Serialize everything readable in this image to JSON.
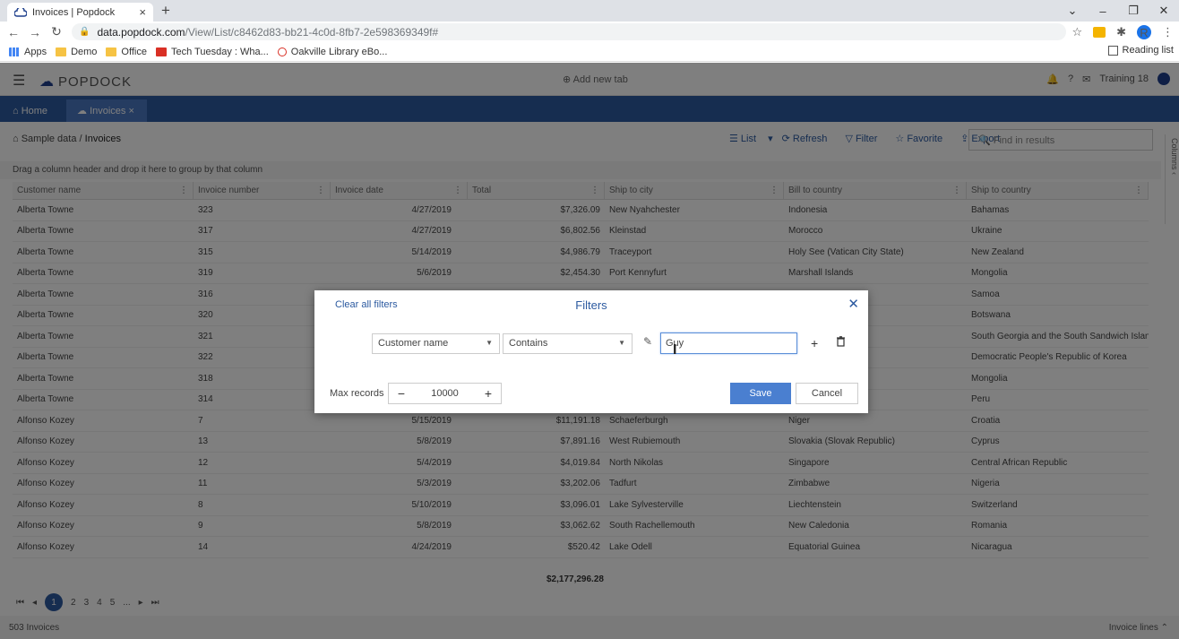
{
  "browser": {
    "tab_title": "Invoices | Popdock",
    "url_host": "data.popdock.com",
    "url_path": "/View/List/c8462d83-bb21-4c0d-8fb7-2e598369349f#",
    "bookmarks": [
      "Apps",
      "Demo",
      "Office",
      "Tech Tuesday : Wha...",
      "Oakville Library eBo..."
    ],
    "reading_list": "Reading list",
    "profile_initial": "R"
  },
  "app": {
    "logo": "POPDOCK",
    "add_new_tab": "Add new tab",
    "user": "Training 18",
    "tabs": [
      "Home",
      "Invoices"
    ],
    "breadcrumb_root": "Sample data",
    "breadcrumb_current": "Invoices",
    "toolbar": [
      "List",
      "Refresh",
      "Filter",
      "Favorite",
      "Export"
    ],
    "find_placeholder": "Find in results",
    "columns_label": "Columns",
    "group_hint": "Drag a column header and drop it here to group by that column",
    "columns": [
      "Customer name",
      "Invoice number",
      "Invoice date",
      "Total",
      "Ship to city",
      "Bill to country",
      "Ship to country"
    ],
    "rows": [
      [
        "Alberta Towne",
        "323",
        "4/27/2019",
        "$7,326.09",
        "New Nyahchester",
        "Indonesia",
        "Bahamas"
      ],
      [
        "Alberta Towne",
        "317",
        "4/27/2019",
        "$6,802.56",
        "Kleinstad",
        "Morocco",
        "Ukraine"
      ],
      [
        "Alberta Towne",
        "315",
        "5/14/2019",
        "$4,986.79",
        "Traceyport",
        "Holy See (Vatican City State)",
        "New Zealand"
      ],
      [
        "Alberta Towne",
        "319",
        "5/6/2019",
        "$2,454.30",
        "Port Kennyfurt",
        "Marshall Islands",
        "Mongolia"
      ],
      [
        "Alberta Towne",
        "316",
        "",
        "",
        "",
        "",
        "Samoa"
      ],
      [
        "Alberta Towne",
        "320",
        "",
        "",
        "",
        "",
        "Botswana"
      ],
      [
        "Alberta Towne",
        "321",
        "",
        "",
        "",
        "",
        "South Georgia and the South Sandwich Islands"
      ],
      [
        "Alberta Towne",
        "322",
        "",
        "",
        "",
        "",
        "Democratic People's Republic of Korea"
      ],
      [
        "Alberta Towne",
        "318",
        "",
        "",
        "",
        "",
        "Mongolia"
      ],
      [
        "Alberta Towne",
        "314",
        "",
        "",
        "",
        "",
        "Peru"
      ],
      [
        "Alfonso Kozey",
        "7",
        "5/15/2019",
        "$11,191.18",
        "Schaeferburgh",
        "Niger",
        "Croatia"
      ],
      [
        "Alfonso Kozey",
        "13",
        "5/8/2019",
        "$7,891.16",
        "West Rubiemouth",
        "Slovakia (Slovak Republic)",
        "Cyprus"
      ],
      [
        "Alfonso Kozey",
        "12",
        "5/4/2019",
        "$4,019.84",
        "North Nikolas",
        "Singapore",
        "Central African Republic"
      ],
      [
        "Alfonso Kozey",
        "11",
        "5/3/2019",
        "$3,202.06",
        "Tadfurt",
        "Zimbabwe",
        "Nigeria"
      ],
      [
        "Alfonso Kozey",
        "8",
        "5/10/2019",
        "$3,096.01",
        "Lake Sylvesterville",
        "Liechtenstein",
        "Switzerland"
      ],
      [
        "Alfonso Kozey",
        "9",
        "5/8/2019",
        "$3,062.62",
        "South Rachellemouth",
        "New Caledonia",
        "Romania"
      ],
      [
        "Alfonso Kozey",
        "14",
        "4/24/2019",
        "$520.42",
        "Lake Odell",
        "Equatorial Guinea",
        "Nicaragua"
      ]
    ],
    "grand_total": "$2,177,296.28",
    "pages": [
      "1",
      "2",
      "3",
      "4",
      "5",
      "..."
    ],
    "record_count": "503 Invoices",
    "invoice_lines": "Invoice lines"
  },
  "modal": {
    "clear_all": "Clear all filters",
    "title": "Filters",
    "field": "Customer name",
    "operator": "Contains",
    "value": "Guy",
    "max_records_label": "Max records",
    "max_records": "10000",
    "save": "Save",
    "cancel": "Cancel"
  }
}
